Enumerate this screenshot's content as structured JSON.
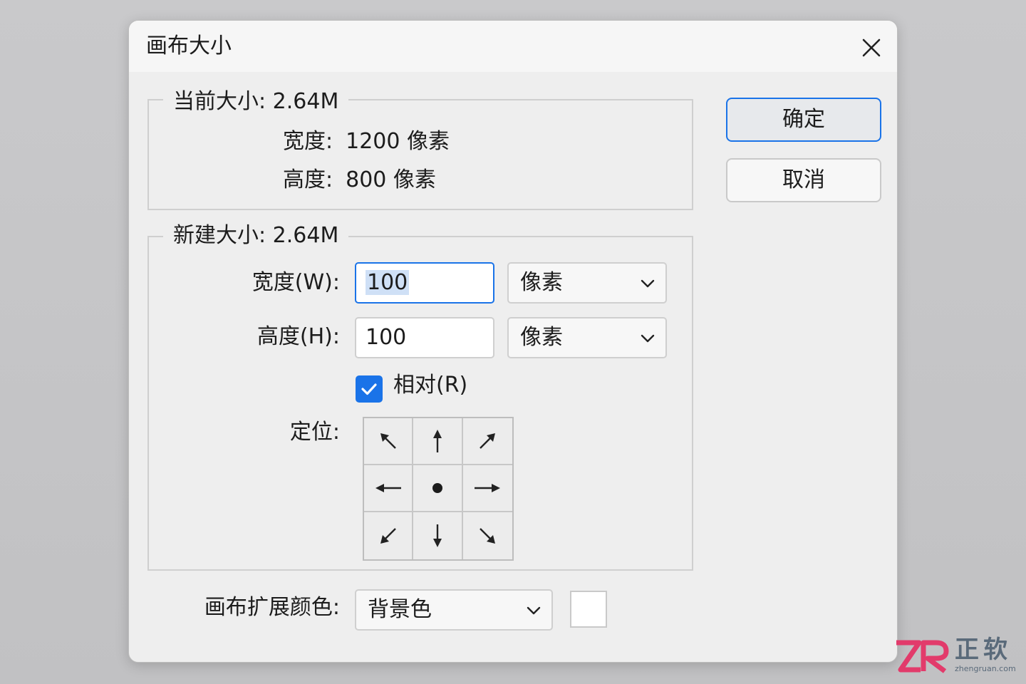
{
  "dialog": {
    "title": "画布大小"
  },
  "current": {
    "legend": "当前大小: 2.64M",
    "width_label": "宽度:",
    "width_value": "1200 像素",
    "height_label": "高度:",
    "height_value": "800 像素"
  },
  "new_size": {
    "legend": "新建大小: 2.64M",
    "width_label": "宽度(W):",
    "width_value": "100",
    "width_unit": "像素",
    "height_label": "高度(H):",
    "height_value": "100",
    "height_unit": "像素",
    "relative_label": "相对(R)",
    "relative_checked": true,
    "anchor_label": "定位:",
    "anchor_selected": "center"
  },
  "extension": {
    "label": "画布扩展颜色:",
    "value": "背景色",
    "swatch_color": "#ffffff"
  },
  "buttons": {
    "ok": "确定",
    "cancel": "取消"
  },
  "watermark": {
    "cn": "正软",
    "en": "zhengruan.com"
  },
  "colors": {
    "accent": "#1a73e8",
    "logo_pink": "#e23b6b"
  },
  "icons": {
    "close": "close-icon",
    "dropdown": "chevron-down-icon",
    "check": "checkmark-icon"
  }
}
